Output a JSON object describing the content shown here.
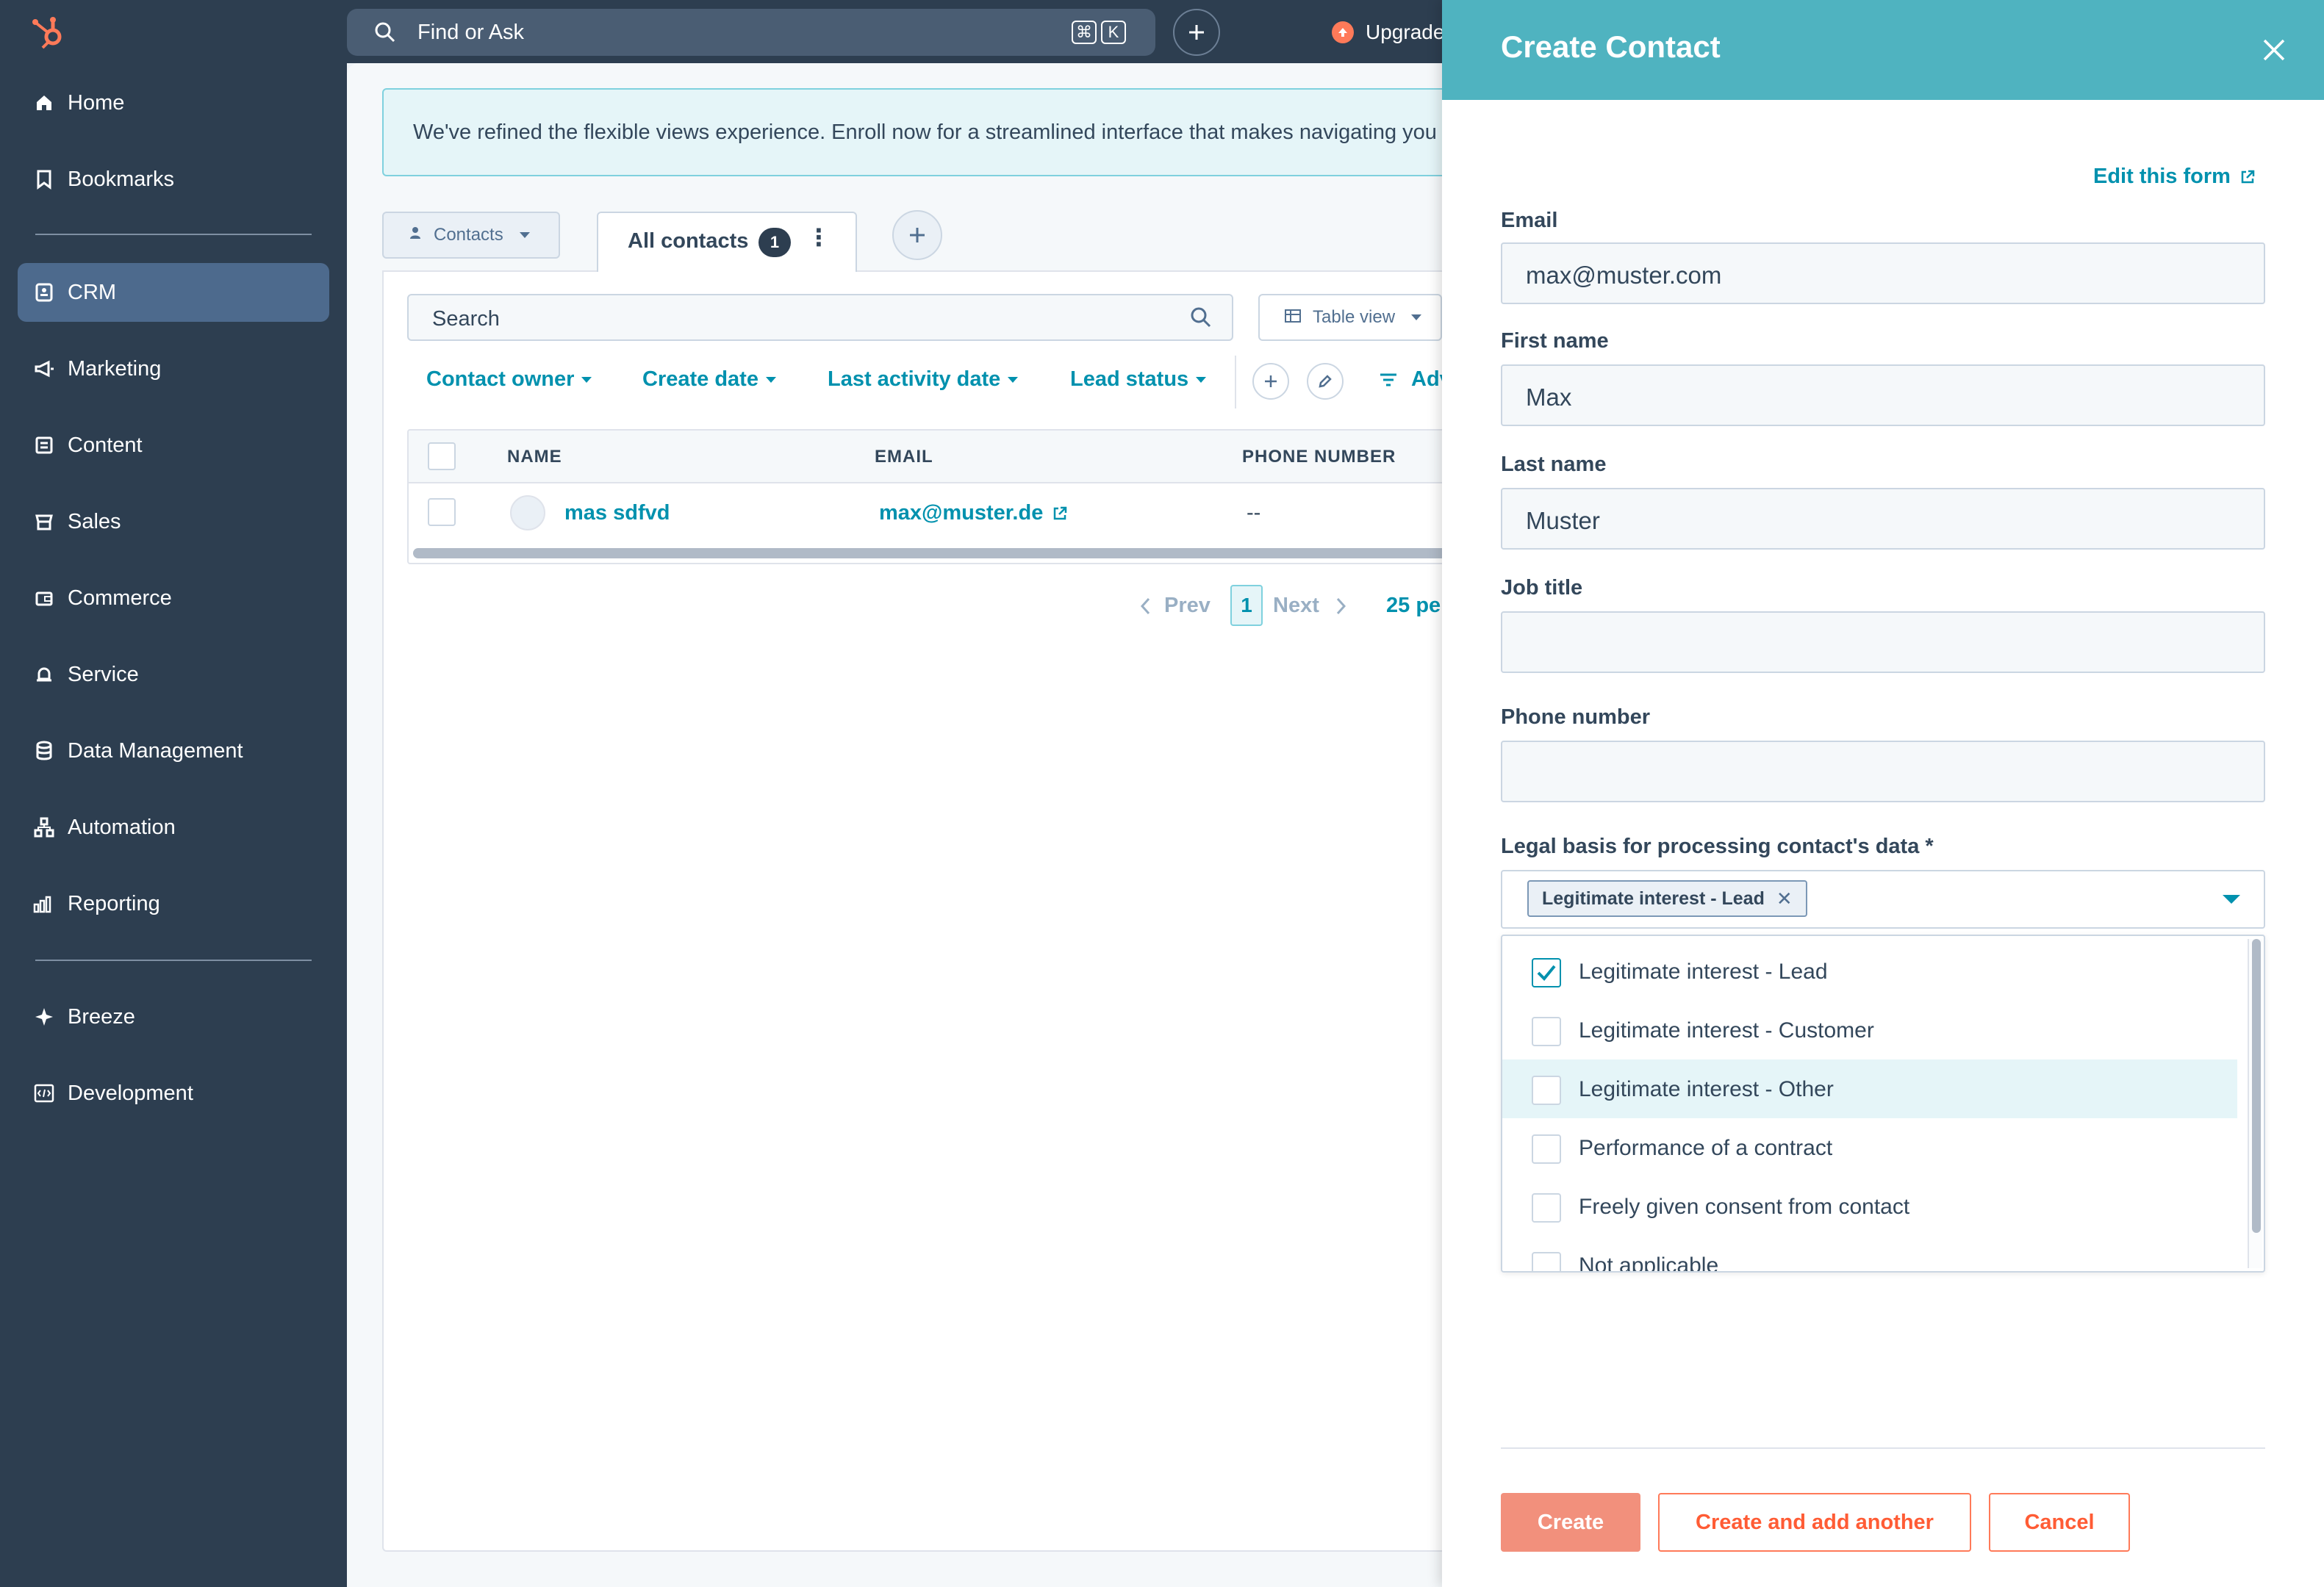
{
  "colors": {
    "sidebar_bg": "#2d3e50",
    "accent": "#0091ae",
    "panel_header": "#4fb3c0",
    "primary_button": "#ff7a59"
  },
  "topbar": {
    "search_placeholder": "Find or Ask",
    "shortcut_keys": [
      "⌘",
      "K"
    ],
    "upgrade_label": "Upgrade"
  },
  "sidebar": {
    "items": [
      {
        "label": "Home",
        "icon": "home-icon"
      },
      {
        "label": "Bookmarks",
        "icon": "bookmark-icon"
      },
      {
        "label": "CRM",
        "icon": "crm-icon",
        "active": true
      },
      {
        "label": "Marketing",
        "icon": "megaphone-icon"
      },
      {
        "label": "Content",
        "icon": "content-icon"
      },
      {
        "label": "Sales",
        "icon": "sales-icon"
      },
      {
        "label": "Commerce",
        "icon": "wallet-icon"
      },
      {
        "label": "Service",
        "icon": "bell-icon"
      },
      {
        "label": "Data Management",
        "icon": "database-icon"
      },
      {
        "label": "Automation",
        "icon": "automation-icon"
      },
      {
        "label": "Reporting",
        "icon": "bar-chart-icon"
      },
      {
        "label": "Breeze",
        "icon": "sparkle-icon"
      },
      {
        "label": "Development",
        "icon": "code-icon"
      }
    ]
  },
  "main": {
    "banner_text": "We've refined the flexible views experience. Enroll now for a streamlined interface that makes navigating you",
    "object_selector": "Contacts",
    "tab": {
      "label": "All contacts",
      "count": "1"
    },
    "list_search_placeholder": "Search",
    "view_selector": "Table view",
    "filters": [
      "Contact owner",
      "Create date",
      "Last activity date",
      "Lead status"
    ],
    "advanced_filters_label": "Adv",
    "table": {
      "columns": [
        "NAME",
        "EMAIL",
        "PHONE NUMBER"
      ],
      "rows": [
        {
          "name": "mas sdfvd",
          "email": "max@muster.de",
          "phone": "--"
        }
      ]
    },
    "pagination": {
      "prev": "Prev",
      "current": "1",
      "next": "Next",
      "per_page": "25 pe"
    }
  },
  "panel": {
    "title": "Create Contact",
    "edit_form_link": "Edit this form",
    "fields": {
      "email": {
        "label": "Email",
        "value": "max@muster.com"
      },
      "first_name": {
        "label": "First name",
        "value": "Max"
      },
      "last_name": {
        "label": "Last name",
        "value": "Muster"
      },
      "job_title": {
        "label": "Job title",
        "value": ""
      },
      "phone": {
        "label": "Phone number",
        "value": ""
      }
    },
    "legal_basis": {
      "label": "Legal basis for processing contact's data *",
      "selected_chip": "Legitimate interest - Lead",
      "options": [
        {
          "label": "Legitimate interest - Lead",
          "checked": true,
          "highlighted": false
        },
        {
          "label": "Legitimate interest - Customer",
          "checked": false,
          "highlighted": false
        },
        {
          "label": "Legitimate interest - Other",
          "checked": false,
          "highlighted": true
        },
        {
          "label": "Performance of a contract",
          "checked": false,
          "highlighted": false
        },
        {
          "label": "Freely given consent from contact",
          "checked": false,
          "highlighted": false
        },
        {
          "label": "Not applicable",
          "checked": false,
          "highlighted": false
        }
      ]
    },
    "buttons": {
      "create": "Create",
      "create_another": "Create and add another",
      "cancel": "Cancel"
    }
  }
}
